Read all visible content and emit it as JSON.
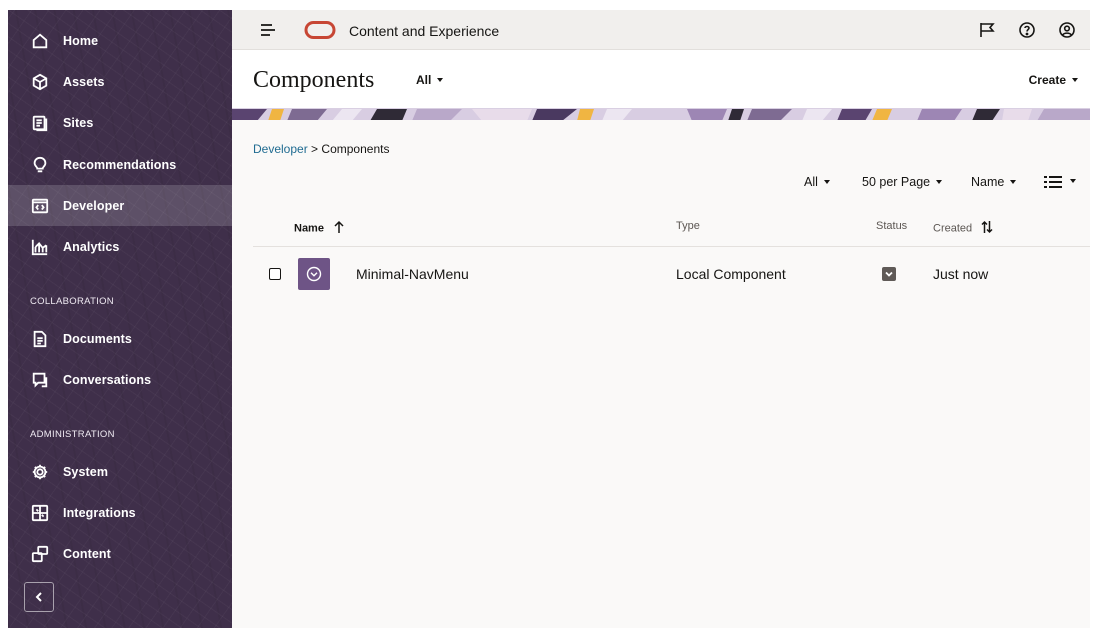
{
  "sidebar": {
    "items": [
      {
        "label": "Home",
        "icon": "home-icon"
      },
      {
        "label": "Assets",
        "icon": "cube-icon"
      },
      {
        "label": "Sites",
        "icon": "sites-icon"
      },
      {
        "label": "Recommendations",
        "icon": "lightbulb-icon"
      },
      {
        "label": "Developer",
        "icon": "code-icon",
        "active": true
      },
      {
        "label": "Analytics",
        "icon": "chart-icon"
      },
      {
        "label": "Documents",
        "icon": "document-icon"
      },
      {
        "label": "Conversations",
        "icon": "conversation-icon"
      },
      {
        "label": "System",
        "icon": "gear-icon"
      },
      {
        "label": "Integrations",
        "icon": "integrations-icon"
      },
      {
        "label": "Content",
        "icon": "content-icon"
      }
    ],
    "sections": {
      "collaboration": "COLLABORATION",
      "administration": "ADMINISTRATION"
    },
    "collapse_icon": "chevron-left-icon"
  },
  "topbar": {
    "app_title": "Content and Experience",
    "icons": [
      "menu-icon",
      "oracle-logo",
      "flag-icon",
      "help-icon",
      "user-icon"
    ]
  },
  "header": {
    "title": "Components",
    "filter": "All",
    "create": "Create"
  },
  "breadcrumb": {
    "parent": "Developer",
    "separator": ">",
    "current": "Components"
  },
  "toolbar": {
    "filter": "All",
    "per_page": "50 per Page",
    "sort": "Name",
    "view_icon": "list-view-icon"
  },
  "table": {
    "columns": {
      "name": "Name",
      "type": "Type",
      "status": "Status",
      "created": "Created"
    },
    "rows": [
      {
        "name": "Minimal-NavMenu",
        "type": "Local Component",
        "status": "published",
        "created": "Just now"
      }
    ]
  },
  "colors": {
    "sidebar_bg": "#3f2f4a",
    "accent_purple": "#6e5486",
    "oracle_red": "#c74634",
    "link_blue": "#1f6b91"
  }
}
